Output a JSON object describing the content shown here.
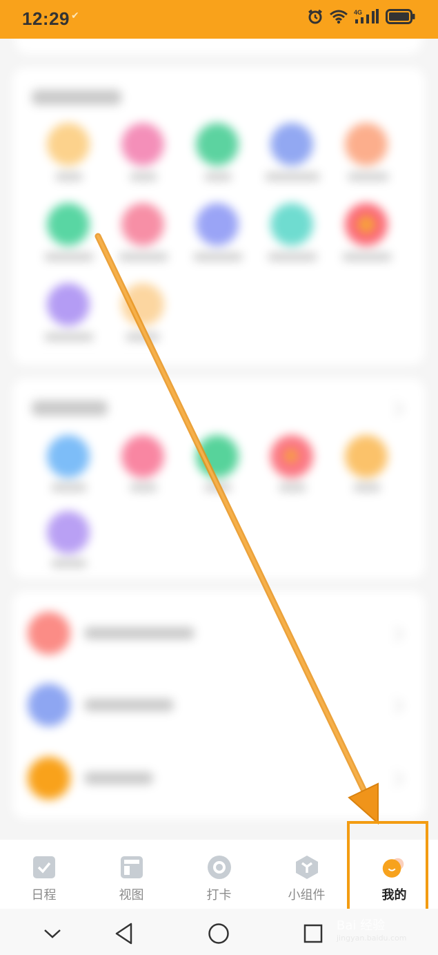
{
  "status_bar": {
    "time": "12:29",
    "icons": [
      "check-icon",
      "alarm-icon",
      "wifi-icon",
      "signal-4g-icon",
      "battery-icon"
    ],
    "network": "4G",
    "background": "#f9a21b"
  },
  "tabs": [
    {
      "label": "日程",
      "icon": "checkbox-icon",
      "active": false
    },
    {
      "label": "视图",
      "icon": "layout-icon",
      "active": false
    },
    {
      "label": "打卡",
      "icon": "target-icon",
      "active": false
    },
    {
      "label": "小组件",
      "icon": "cube-icon",
      "active": false
    },
    {
      "label": "我的",
      "icon": "smiley-icon",
      "active": true
    }
  ],
  "navbar": {
    "buttons": [
      "chevron-down-icon",
      "back-triangle-icon",
      "home-circle-icon",
      "recents-square-icon"
    ]
  },
  "watermark": {
    "text": "Bai 经验",
    "sub": "jingyan.baidu.com"
  },
  "colors": {
    "accent": "#f9a21b",
    "annotation": "#f39c12",
    "tab_inactive": "#8a8a8a",
    "tab_active": "#222222"
  }
}
